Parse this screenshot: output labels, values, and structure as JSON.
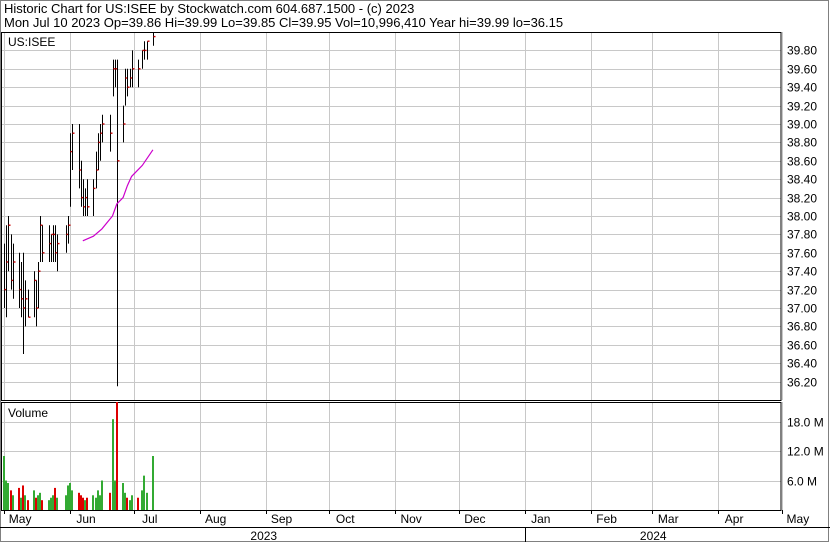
{
  "header": {
    "line1": "Historic Chart for US:ISEE by Stockwatch.com 604.687.1500 - (c) 2023",
    "line2": "Mon Jul 10 2023   Op=39.86  Hi=39.99  Lo=39.85  Cl=39.95  Vol=10,996,410  Year hi=39.99  lo=36.15"
  },
  "colors": {
    "grid": "#c8c8c8",
    "up_bar": "#000000",
    "close_tick": "#cc0000",
    "moving_average": "#cc00cc",
    "vol_up": "#33aa33",
    "vol_down": "#dd0000",
    "frame": "#000000"
  },
  "chart_data": [
    {
      "type": "ohlc",
      "title": "US:ISEE",
      "y_ticks": [
        "39.80",
        "39.60",
        "39.40",
        "39.20",
        "39.00",
        "38.80",
        "38.60",
        "38.40",
        "38.20",
        "38.00",
        "37.80",
        "37.60",
        "37.40",
        "37.20",
        "37.00",
        "36.80",
        "36.60",
        "36.40",
        "36.20"
      ],
      "ylim": [
        36.0,
        40.0
      ],
      "x_months": [
        "May",
        "Jun",
        "Jul",
        "Aug",
        "Sep",
        "Oct",
        "Nov",
        "Dec",
        "Jan",
        "Feb",
        "Mar",
        "Apr",
        "May"
      ],
      "x_years": [
        "2023",
        "2024"
      ],
      "bars": [
        {
          "date": "2023-05-01",
          "o": 37.4,
          "h": 37.7,
          "l": 37.0,
          "c": 37.2
        },
        {
          "date": "2023-05-02",
          "o": 37.3,
          "h": 37.9,
          "l": 36.9,
          "c": 37.5
        },
        {
          "date": "2023-05-03",
          "o": 37.5,
          "h": 38.0,
          "l": 37.4,
          "c": 37.9
        },
        {
          "date": "2023-05-04",
          "o": 37.6,
          "h": 37.8,
          "l": 37.2,
          "c": 37.3
        },
        {
          "date": "2023-05-05",
          "o": 37.4,
          "h": 37.7,
          "l": 37.1,
          "c": 37.5
        },
        {
          "date": "2023-05-08",
          "o": 37.3,
          "h": 37.6,
          "l": 37.0,
          "c": 37.2
        },
        {
          "date": "2023-05-09",
          "o": 37.2,
          "h": 37.5,
          "l": 36.9,
          "c": 37.1
        },
        {
          "date": "2023-05-10",
          "o": 37.1,
          "h": 37.6,
          "l": 36.5,
          "c": 37.0
        },
        {
          "date": "2023-05-11",
          "o": 37.0,
          "h": 37.3,
          "l": 36.8,
          "c": 37.1
        },
        {
          "date": "2023-05-12",
          "o": 37.0,
          "h": 37.2,
          "l": 36.9,
          "c": 36.9
        },
        {
          "date": "2023-05-15",
          "o": 37.0,
          "h": 37.4,
          "l": 36.9,
          "c": 37.3
        },
        {
          "date": "2023-05-16",
          "o": 37.1,
          "h": 37.3,
          "l": 36.8,
          "c": 37.0
        },
        {
          "date": "2023-05-17",
          "o": 37.1,
          "h": 37.5,
          "l": 37.0,
          "c": 37.4
        },
        {
          "date": "2023-05-18",
          "o": 37.6,
          "h": 38.0,
          "l": 37.5,
          "c": 37.9
        },
        {
          "date": "2023-05-19",
          "o": 37.7,
          "h": 37.9,
          "l": 37.5,
          "c": 37.6
        },
        {
          "date": "2023-05-22",
          "o": 37.6,
          "h": 37.9,
          "l": 37.5,
          "c": 37.7
        },
        {
          "date": "2023-05-23",
          "o": 37.7,
          "h": 37.8,
          "l": 37.5,
          "c": 37.8
        },
        {
          "date": "2023-05-24",
          "o": 37.6,
          "h": 37.9,
          "l": 37.5,
          "c": 37.8
        },
        {
          "date": "2023-05-25",
          "o": 37.7,
          "h": 37.9,
          "l": 37.5,
          "c": 37.6
        },
        {
          "date": "2023-05-26",
          "o": 37.6,
          "h": 37.8,
          "l": 37.4,
          "c": 37.7
        },
        {
          "date": "2023-05-30",
          "o": 37.7,
          "h": 37.9,
          "l": 37.6,
          "c": 37.8
        },
        {
          "date": "2023-05-31",
          "o": 37.8,
          "h": 38.0,
          "l": 37.7,
          "c": 37.9
        },
        {
          "date": "2023-06-01",
          "o": 38.3,
          "h": 38.9,
          "l": 38.1,
          "c": 38.7
        },
        {
          "date": "2023-06-02",
          "o": 38.7,
          "h": 39.0,
          "l": 38.5,
          "c": 38.9
        },
        {
          "date": "2023-06-05",
          "o": 38.8,
          "h": 39.0,
          "l": 38.3,
          "c": 38.5
        },
        {
          "date": "2023-06-06",
          "o": 38.4,
          "h": 38.6,
          "l": 38.1,
          "c": 38.2
        },
        {
          "date": "2023-06-07",
          "o": 38.2,
          "h": 38.4,
          "l": 38.0,
          "c": 38.1
        },
        {
          "date": "2023-06-08",
          "o": 38.1,
          "h": 38.3,
          "l": 38.0,
          "c": 38.2
        },
        {
          "date": "2023-06-09",
          "o": 38.2,
          "h": 38.4,
          "l": 38.0,
          "c": 38.1
        },
        {
          "date": "2023-06-12",
          "o": 38.1,
          "h": 38.4,
          "l": 38.0,
          "c": 38.3
        },
        {
          "date": "2023-06-13",
          "o": 38.4,
          "h": 38.7,
          "l": 38.3,
          "c": 38.5
        },
        {
          "date": "2023-06-14",
          "o": 38.6,
          "h": 38.9,
          "l": 38.5,
          "c": 38.8
        },
        {
          "date": "2023-06-15",
          "o": 38.8,
          "h": 39.0,
          "l": 38.6,
          "c": 38.9
        },
        {
          "date": "2023-06-16",
          "o": 38.9,
          "h": 39.1,
          "l": 38.8,
          "c": 39.0
        },
        {
          "date": "2023-06-20",
          "o": 39.0,
          "h": 39.1,
          "l": 38.7,
          "c": 38.9
        },
        {
          "date": "2023-06-21",
          "o": 39.4,
          "h": 39.7,
          "l": 39.3,
          "c": 39.6
        },
        {
          "date": "2023-06-22",
          "o": 39.5,
          "h": 39.7,
          "l": 39.4,
          "c": 39.6
        },
        {
          "date": "2023-06-23",
          "o": 38.6,
          "h": 39.7,
          "l": 36.15,
          "c": 38.6
        },
        {
          "date": "2023-06-26",
          "o": 39.0,
          "h": 39.2,
          "l": 38.8,
          "c": 39.0
        },
        {
          "date": "2023-06-27",
          "o": 39.4,
          "h": 39.6,
          "l": 39.2,
          "c": 39.5
        },
        {
          "date": "2023-06-28",
          "o": 39.5,
          "h": 39.6,
          "l": 39.3,
          "c": 39.4
        },
        {
          "date": "2023-06-29",
          "o": 39.5,
          "h": 39.6,
          "l": 39.4,
          "c": 39.5
        },
        {
          "date": "2023-06-30",
          "o": 39.5,
          "h": 39.8,
          "l": 39.4,
          "c": 39.6
        },
        {
          "date": "2023-07-03",
          "o": 39.6,
          "h": 39.7,
          "l": 39.4,
          "c": 39.6
        },
        {
          "date": "2023-07-05",
          "o": 39.7,
          "h": 39.8,
          "l": 39.6,
          "c": 39.8
        },
        {
          "date": "2023-07-06",
          "o": 39.8,
          "h": 39.9,
          "l": 39.7,
          "c": 39.8
        },
        {
          "date": "2023-07-07",
          "o": 39.8,
          "h": 39.9,
          "l": 39.7,
          "c": 39.9
        },
        {
          "date": "2023-07-10",
          "o": 39.86,
          "h": 39.99,
          "l": 39.85,
          "c": 39.95
        }
      ],
      "moving_average": [
        {
          "date": "2023-06-07",
          "v": 37.73
        },
        {
          "date": "2023-06-12",
          "v": 37.78
        },
        {
          "date": "2023-06-16",
          "v": 37.86
        },
        {
          "date": "2023-06-21",
          "v": 38.0
        },
        {
          "date": "2023-06-23",
          "v": 38.13
        },
        {
          "date": "2023-06-26",
          "v": 38.2
        },
        {
          "date": "2023-06-28",
          "v": 38.33
        },
        {
          "date": "2023-06-30",
          "v": 38.43
        },
        {
          "date": "2023-07-05",
          "v": 38.55
        },
        {
          "date": "2023-07-10",
          "v": 38.72
        }
      ]
    },
    {
      "type": "bar",
      "title": "Volume",
      "y_ticks": [
        "18.0 M",
        "12.0 M",
        "6.0 M"
      ],
      "ylim": [
        0,
        22
      ],
      "unit": "M",
      "values": [
        {
          "date": "2023-05-01",
          "v": 11.0,
          "up": true
        },
        {
          "date": "2023-05-02",
          "v": 6.0,
          "up": true
        },
        {
          "date": "2023-05-03",
          "v": 5.5,
          "up": true
        },
        {
          "date": "2023-05-04",
          "v": 4.0,
          "up": false
        },
        {
          "date": "2023-05-05",
          "v": 3.0,
          "up": true
        },
        {
          "date": "2023-05-08",
          "v": 4.5,
          "up": false
        },
        {
          "date": "2023-05-09",
          "v": 2.5,
          "up": true
        },
        {
          "date": "2023-05-10",
          "v": 5.0,
          "up": false
        },
        {
          "date": "2023-05-11",
          "v": 3.0,
          "up": true
        },
        {
          "date": "2023-05-12",
          "v": 2.0,
          "up": false
        },
        {
          "date": "2023-05-15",
          "v": 4.0,
          "up": true
        },
        {
          "date": "2023-05-16",
          "v": 2.5,
          "up": false
        },
        {
          "date": "2023-05-17",
          "v": 3.0,
          "up": true
        },
        {
          "date": "2023-05-18",
          "v": 3.5,
          "up": true
        },
        {
          "date": "2023-05-19",
          "v": 2.0,
          "up": false
        },
        {
          "date": "2023-05-22",
          "v": 2.0,
          "up": true
        },
        {
          "date": "2023-05-23",
          "v": 2.5,
          "up": true
        },
        {
          "date": "2023-05-24",
          "v": 3.0,
          "up": true
        },
        {
          "date": "2023-05-25",
          "v": 4.5,
          "up": false
        },
        {
          "date": "2023-05-26",
          "v": 2.5,
          "up": true
        },
        {
          "date": "2023-05-30",
          "v": 3.0,
          "up": true
        },
        {
          "date": "2023-05-31",
          "v": 5.0,
          "up": true
        },
        {
          "date": "2023-06-01",
          "v": 5.5,
          "up": true
        },
        {
          "date": "2023-06-02",
          "v": 4.0,
          "up": true
        },
        {
          "date": "2023-06-05",
          "v": 3.5,
          "up": false
        },
        {
          "date": "2023-06-06",
          "v": 3.0,
          "up": false
        },
        {
          "date": "2023-06-07",
          "v": 2.5,
          "up": false
        },
        {
          "date": "2023-06-08",
          "v": 2.0,
          "up": true
        },
        {
          "date": "2023-06-09",
          "v": 2.5,
          "up": false
        },
        {
          "date": "2023-06-12",
          "v": 3.0,
          "up": true
        },
        {
          "date": "2023-06-13",
          "v": 2.5,
          "up": true
        },
        {
          "date": "2023-06-14",
          "v": 4.0,
          "up": true
        },
        {
          "date": "2023-06-15",
          "v": 3.0,
          "up": true
        },
        {
          "date": "2023-06-16",
          "v": 6.0,
          "up": true
        },
        {
          "date": "2023-06-20",
          "v": 3.5,
          "up": false
        },
        {
          "date": "2023-06-21",
          "v": 18.5,
          "up": true
        },
        {
          "date": "2023-06-22",
          "v": 6.0,
          "up": true
        },
        {
          "date": "2023-06-23",
          "v": 22.0,
          "up": false
        },
        {
          "date": "2023-06-26",
          "v": 5.5,
          "up": true
        },
        {
          "date": "2023-06-27",
          "v": 3.5,
          "up": true
        },
        {
          "date": "2023-06-28",
          "v": 2.5,
          "up": false
        },
        {
          "date": "2023-06-29",
          "v": 2.0,
          "up": true
        },
        {
          "date": "2023-06-30",
          "v": 3.0,
          "up": true
        },
        {
          "date": "2023-07-03",
          "v": 2.5,
          "up": false
        },
        {
          "date": "2023-07-05",
          "v": 4.0,
          "up": true
        },
        {
          "date": "2023-07-06",
          "v": 7.0,
          "up": true
        },
        {
          "date": "2023-07-07",
          "v": 3.5,
          "up": true
        },
        {
          "date": "2023-07-10",
          "v": 11.0,
          "up": true
        }
      ]
    }
  ]
}
